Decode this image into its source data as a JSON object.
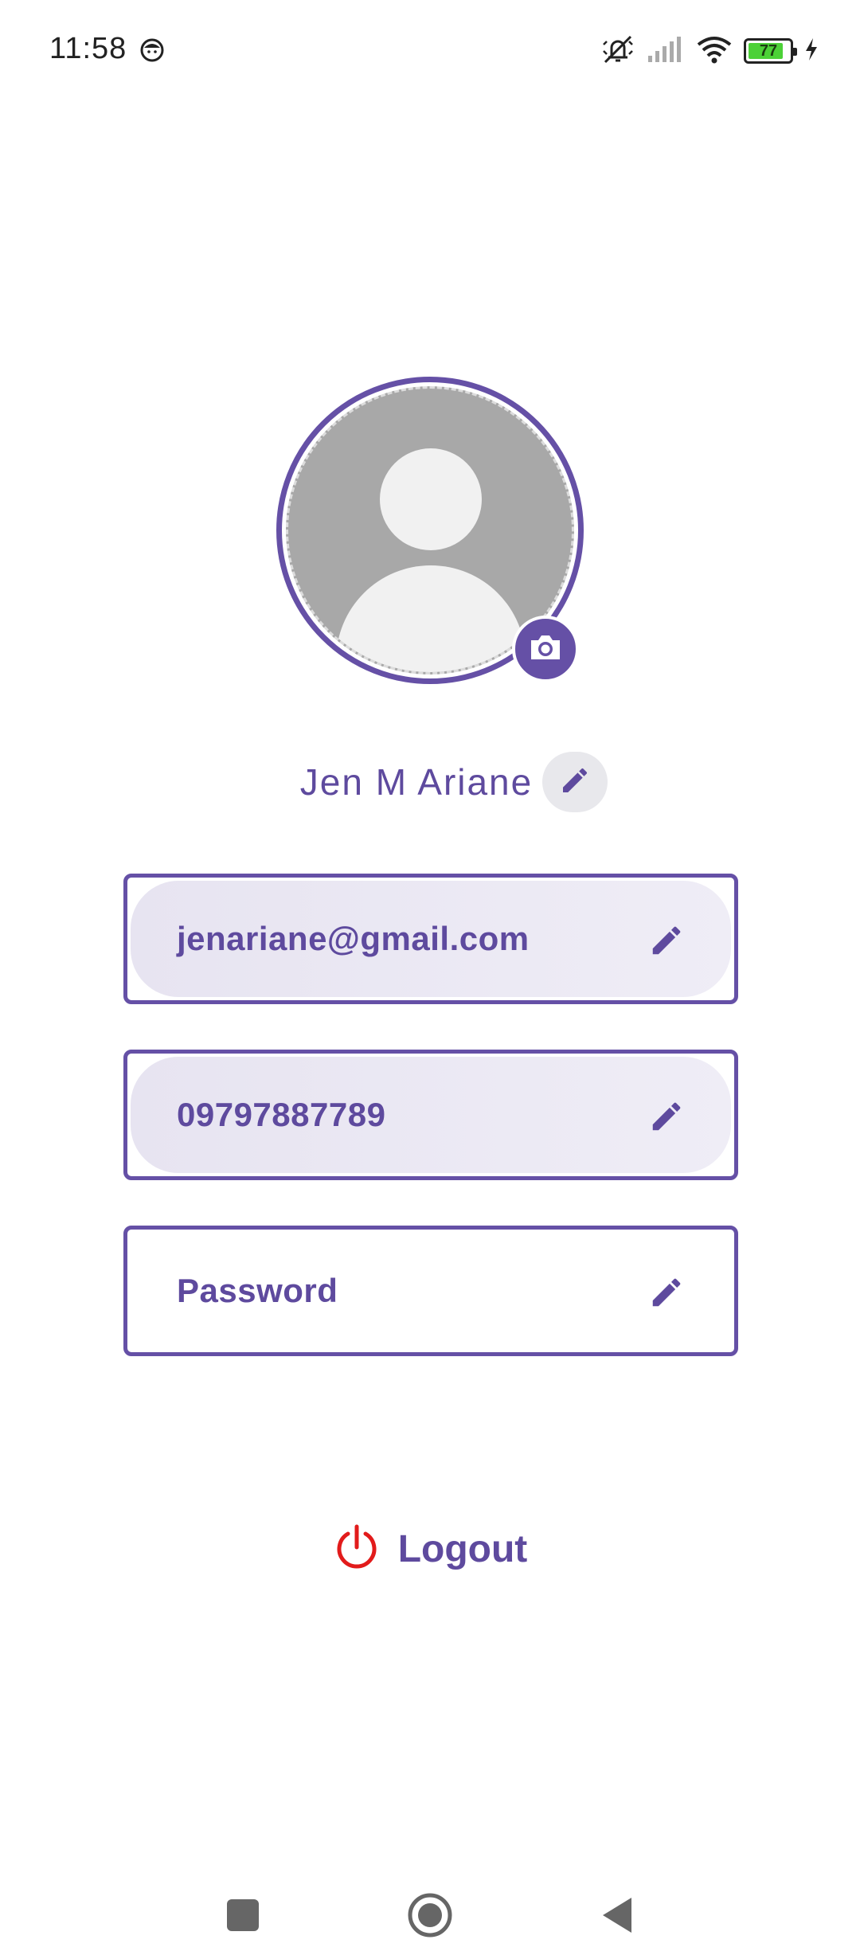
{
  "status_bar": {
    "time": "11:58",
    "battery_level": "77",
    "icons": [
      "face-icon",
      "mute-icon",
      "signal-icon",
      "wifi-icon",
      "battery-icon",
      "charging-icon"
    ]
  },
  "profile": {
    "name": "Jen M Ariane",
    "avatar_icon": "person-placeholder-icon",
    "camera_icon": "camera-icon"
  },
  "fields": [
    {
      "value": "jenariane@gmail.com",
      "icon": "pencil-icon"
    },
    {
      "value": "09797887789",
      "icon": "pencil-icon"
    },
    {
      "value": "Password",
      "icon": "pencil-icon"
    }
  ],
  "logout": {
    "label": "Logout",
    "icon": "power-icon",
    "icon_color": "#e21b1b"
  },
  "navigation": {
    "items": [
      "recents-button",
      "home-button",
      "back-button"
    ]
  },
  "colors": {
    "accent": "#6550a6",
    "text_accent": "#5e4a9e",
    "danger": "#e21b1b"
  }
}
